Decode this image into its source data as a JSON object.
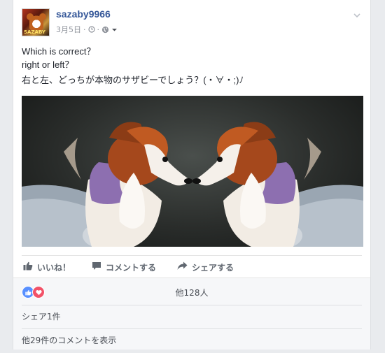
{
  "post": {
    "author": "sazaby9966",
    "date": "3月5日",
    "meta_sep": "·",
    "text_lines": [
      "Which is correct？",
      "right or left？",
      "右と左、どっちが本物のサザビーでしょう？(・∀・;)ﾉ"
    ],
    "avatar_text": "SAZABY"
  },
  "actions": {
    "like": "いいね！",
    "comment": "コメントする",
    "share": "シェアする"
  },
  "footer": {
    "reaction_count": "他128人",
    "shares": "シェア1件",
    "view_comments": "他29件のコメントを表示"
  },
  "icons": {
    "privacy": "clock-icon",
    "audience": "globe-icon",
    "menu": "chevron-down-icon",
    "like": "thumbs-up-icon",
    "comment": "comment-icon",
    "share": "share-arrow-icon"
  },
  "colors": {
    "author_link": "#365899",
    "like_reaction": "#5890ff",
    "love_reaction": "#f25268"
  }
}
